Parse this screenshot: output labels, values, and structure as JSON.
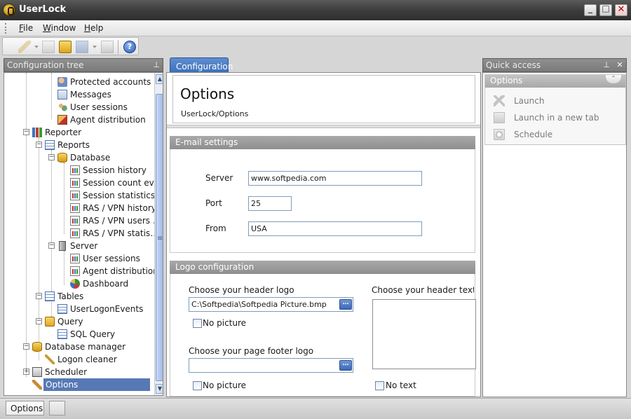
{
  "window": {
    "title": "UserLock"
  },
  "menu": {
    "items": [
      "File",
      "Window",
      "Help"
    ]
  },
  "config_tree": {
    "title": "Configuration tree",
    "items": [
      {
        "label": "Protected accounts",
        "icon": "shield-user-icon"
      },
      {
        "label": "Messages",
        "icon": "messages-icon"
      },
      {
        "label": "User sessions",
        "icon": "users-icon"
      },
      {
        "label": "Agent distribution",
        "icon": "agent-icon"
      },
      {
        "label": "Reporter",
        "icon": "reporter-icon"
      },
      {
        "label": "Reports",
        "icon": "reports-icon"
      },
      {
        "label": "Database",
        "icon": "database-icon"
      },
      {
        "label": "Session history",
        "icon": "report-icon"
      },
      {
        "label": "Session count ev…",
        "icon": "report-icon"
      },
      {
        "label": "Session statistics",
        "icon": "report-icon"
      },
      {
        "label": "RAS / VPN history",
        "icon": "report-icon"
      },
      {
        "label": "RAS / VPN users …",
        "icon": "report-icon"
      },
      {
        "label": "RAS / VPN statis…",
        "icon": "report-icon"
      },
      {
        "label": "Server",
        "icon": "server-icon"
      },
      {
        "label": "User sessions",
        "icon": "report-icon"
      },
      {
        "label": "Agent distribution",
        "icon": "report-icon"
      },
      {
        "label": "Dashboard",
        "icon": "dashboard-icon"
      },
      {
        "label": "Tables",
        "icon": "table-icon"
      },
      {
        "label": "UserLogonEvents",
        "icon": "table-icon"
      },
      {
        "label": "Query",
        "icon": "query-icon"
      },
      {
        "label": "SQL Query",
        "icon": "table-icon"
      },
      {
        "label": "Database manager",
        "icon": "database-manager-icon"
      },
      {
        "label": "Logon cleaner",
        "icon": "cleaner-icon"
      },
      {
        "label": "Scheduler",
        "icon": "scheduler-icon"
      },
      {
        "label": "Options",
        "icon": "wrench-icon",
        "selected": true
      }
    ]
  },
  "tab": {
    "label": "Configuration"
  },
  "page": {
    "title": "Options",
    "breadcrumb": "UserLock/Options"
  },
  "email_settings": {
    "title": "E-mail settings",
    "server_label": "Server",
    "server_value": "www.softpedia.com",
    "port_label": "Port",
    "port_value": "25",
    "from_label": "From",
    "from_value": "USA"
  },
  "logo_config": {
    "title": "Logo configuration",
    "header_logo_label": "Choose your header logo",
    "header_logo_value": "C:\\Softpedia\\Softpedia Picture.bmp",
    "header_no_picture": "No picture",
    "header_text_label": "Choose your header text / slog",
    "footer_logo_label": "Choose your page footer logo",
    "footer_logo_value": "",
    "footer_no_picture": "No picture",
    "no_text": "No text"
  },
  "quick_access": {
    "title": "Quick access",
    "section": "Options",
    "items": [
      {
        "label": "Launch",
        "icon": "lightning-icon"
      },
      {
        "label": "Launch in a new tab",
        "icon": "new-tab-icon"
      },
      {
        "label": "Schedule",
        "icon": "schedule-icon"
      }
    ]
  },
  "statusbar": {
    "tab_label": "Options"
  }
}
